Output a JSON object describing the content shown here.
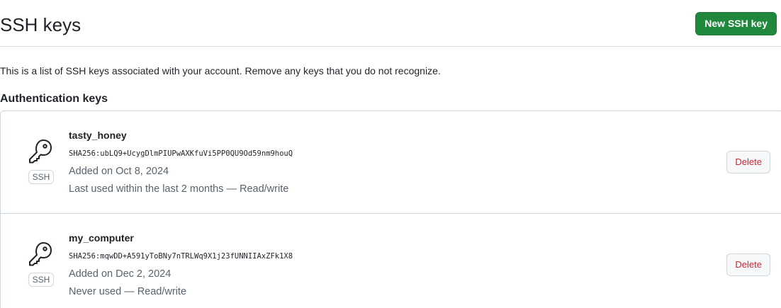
{
  "header": {
    "title": "SSH keys",
    "new_key_label": "New SSH key"
  },
  "intro": "This is a list of SSH keys associated with your account. Remove any keys that you do not recognize.",
  "section_title": "Authentication keys",
  "keys": [
    {
      "title": "tasty_honey",
      "fingerprint": "SHA256:ubLQ9+UcygDlmPIUPwAXKfuVi5PP0QU9Od59nm9houQ",
      "added": "Added on Oct 8, 2024",
      "usage": "Last used within the last 2 months — Read/write",
      "badge": "SSH",
      "delete_label": "Delete",
      "icon": "key-icon"
    },
    {
      "title": "my_computer",
      "fingerprint": "SHA256:mqwDD+A591yToBNy7nTRLWq9X1j23fUNNIIAxZFk1X8",
      "added": "Added on Dec 2, 2024",
      "usage": "Never used — Read/write",
      "badge": "SSH",
      "delete_label": "Delete",
      "icon": "key-icon"
    }
  ],
  "colors": {
    "primary_button": "#1f883d",
    "danger_text": "#d1242f",
    "border": "#d0d7de",
    "muted_text": "#59636e"
  }
}
